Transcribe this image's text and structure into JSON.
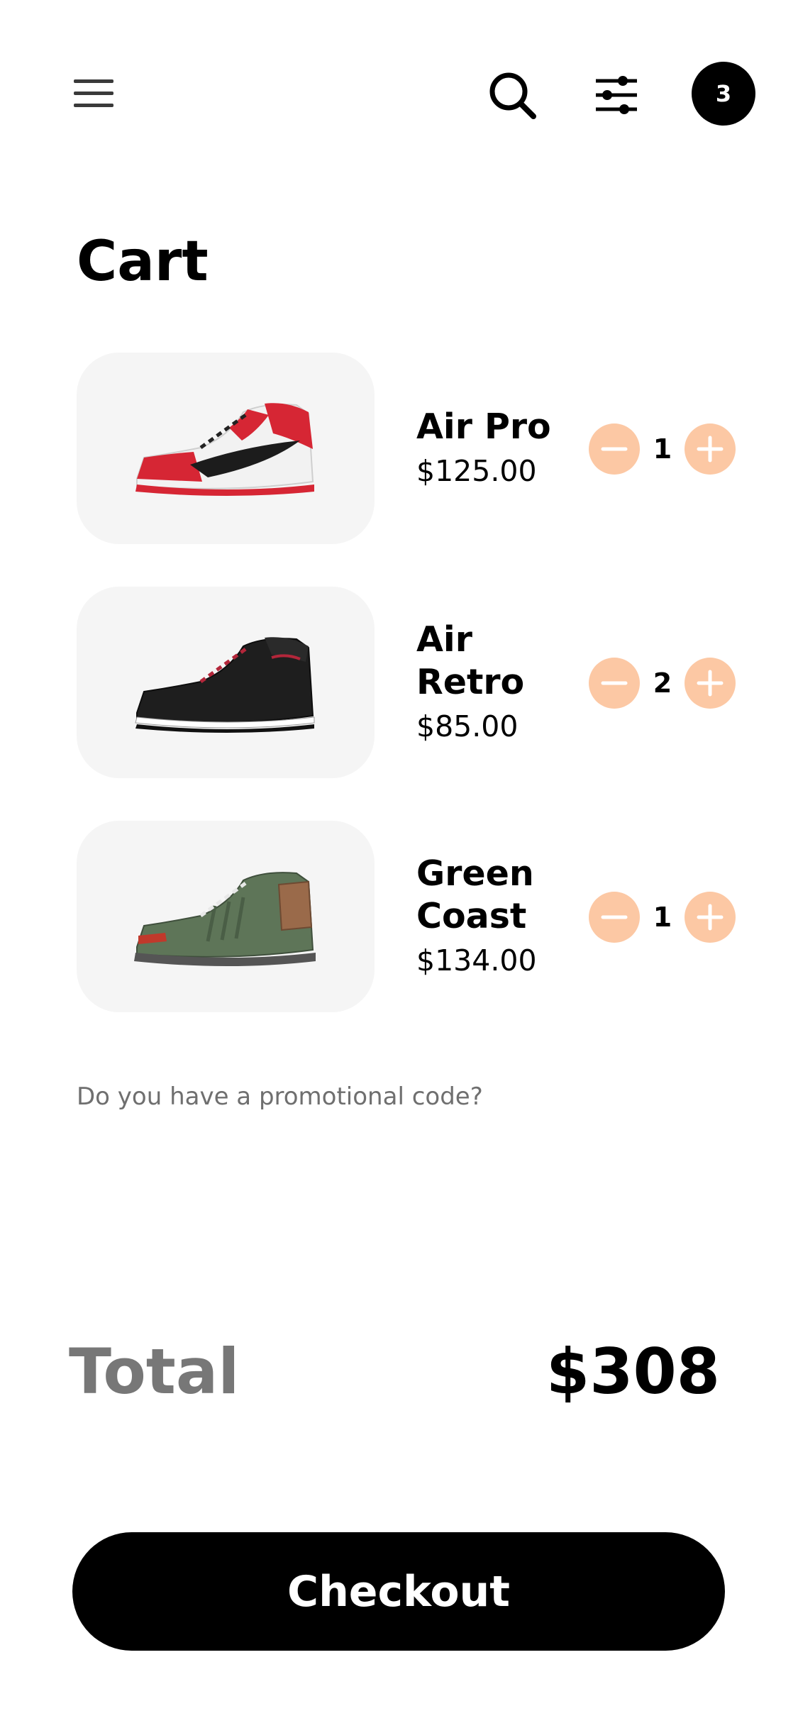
{
  "header": {
    "cart_count": "3"
  },
  "page": {
    "title": "Cart"
  },
  "cart": {
    "items": [
      {
        "name": "Air Pro",
        "price": "$125.00",
        "quantity": "1",
        "image": "red-white-black-high-top-sneaker"
      },
      {
        "name": "Air Retro",
        "price": "$85.00",
        "quantity": "2",
        "image": "black-red-high-top-sneaker"
      },
      {
        "name": "Green Coast",
        "price": "$134.00",
        "quantity": "1",
        "image": "green-grey-high-top-sneaker"
      }
    ],
    "promo_text": "Do you have a promotional code?",
    "total_label": "Total",
    "total_value": "$308",
    "checkout_label": "Checkout"
  },
  "colors": {
    "accent_peach": "#fcc8a4",
    "primary": "#000000",
    "muted_text": "#777777",
    "card_background": "#f5f5f5"
  },
  "icons": [
    "hamburger-menu-icon",
    "search-icon",
    "filter-sliders-icon",
    "minus-icon",
    "plus-icon"
  ]
}
